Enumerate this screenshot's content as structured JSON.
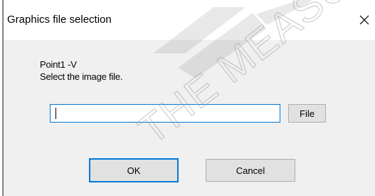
{
  "dialog": {
    "title": "Graphics file selection",
    "close_glyph": "✕"
  },
  "prompt": {
    "line1": "Point1 -V",
    "line2": "Select the image file."
  },
  "file_input": {
    "value": "",
    "placeholder": ""
  },
  "buttons": {
    "file_label": "File",
    "ok_label": "OK",
    "cancel_label": "Cancel"
  },
  "watermark": {
    "text": "THE MEASU"
  },
  "colors": {
    "accent": "#0078d7",
    "dialog_bg": "#f0f0f0",
    "titlebar_bg": "#ffffff",
    "button_bg": "#e1e1e1",
    "button_border": "#adadad"
  },
  "icons": {
    "close": "close-icon"
  }
}
